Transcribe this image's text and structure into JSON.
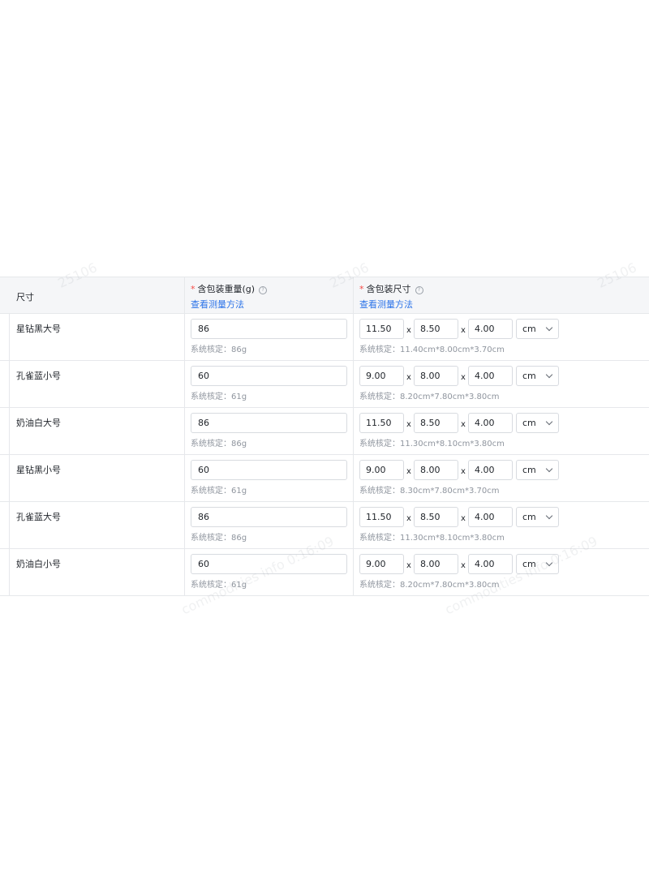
{
  "headers": {
    "size": "尺寸",
    "weight": "含包装重量(g)",
    "dims": "含包装尺寸",
    "measure_link": "查看测量方法",
    "required_mark": "*",
    "help_icon": "question-circle-icon"
  },
  "rows": [
    {
      "name": "星钻黑大号",
      "weight": "86",
      "weight_hint": "系统核定：86g",
      "length": "11.50",
      "width": "8.50",
      "height": "4.00",
      "unit": "cm",
      "dims_hint": "系统核定：11.40cm*8.00cm*3.70cm"
    },
    {
      "name": "孔雀蓝小号",
      "weight": "60",
      "weight_hint": "系统核定：61g",
      "length": "9.00",
      "width": "8.00",
      "height": "4.00",
      "unit": "cm",
      "dims_hint": "系统核定：8.20cm*7.80cm*3.80cm"
    },
    {
      "name": "奶油白大号",
      "weight": "86",
      "weight_hint": "系统核定：86g",
      "length": "11.50",
      "width": "8.50",
      "height": "4.00",
      "unit": "cm",
      "dims_hint": "系统核定：11.30cm*8.10cm*3.80cm"
    },
    {
      "name": "星钻黑小号",
      "weight": "60",
      "weight_hint": "系统核定：61g",
      "length": "9.00",
      "width": "8.00",
      "height": "4.00",
      "unit": "cm",
      "dims_hint": "系统核定：8.30cm*7.80cm*3.70cm"
    },
    {
      "name": "孔雀蓝大号",
      "weight": "86",
      "weight_hint": "系统核定：86g",
      "length": "11.50",
      "width": "8.50",
      "height": "4.00",
      "unit": "cm",
      "dims_hint": "系统核定：11.30cm*8.10cm*3.80cm"
    },
    {
      "name": "奶油白小号",
      "weight": "60",
      "weight_hint": "系统核定：61g",
      "length": "9.00",
      "width": "8.00",
      "height": "4.00",
      "unit": "cm",
      "dims_hint": "系统核定：8.20cm*7.80cm*3.80cm"
    }
  ],
  "dims_separator": "x",
  "watermark": {
    "id": "25106",
    "site": "commodities info",
    "time": "0:16:09"
  }
}
